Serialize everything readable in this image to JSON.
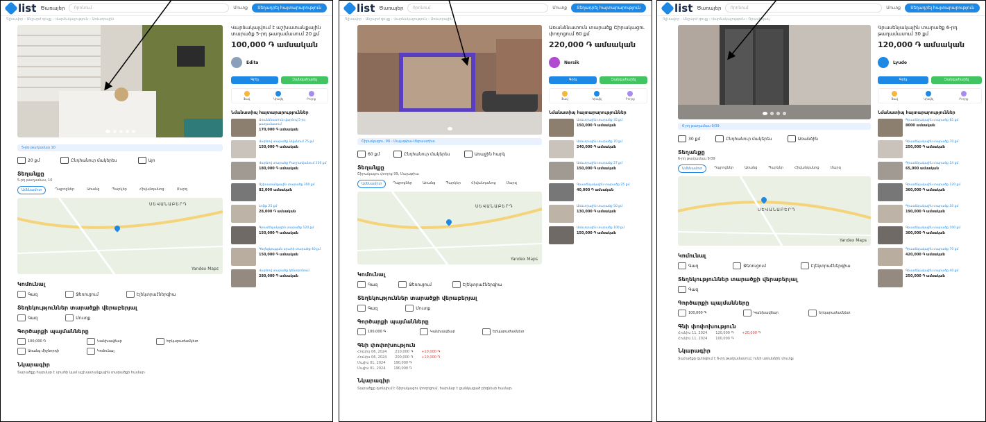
{
  "header": {
    "logo": "list",
    "category": "Ծառայեր",
    "search_placeholder": "Որոնում",
    "login": "Մուտք",
    "post_button": "Տեղադրել հայտարարություն"
  },
  "panels": [
    {
      "title": "Վարձակալվում է աշխատանքային տարածք 5-րդ թաղամասում 20 քմ",
      "price": "100,000 ֏ ամսական",
      "seller": "Edita",
      "strip": "5-րդ թաղամաս 10",
      "features": [
        "20 քմ",
        "Ընդհանուր մակերես",
        "Այո"
      ],
      "address": "5-րդ թաղամաս, 10",
      "similar": [
        {
          "t": "Առանձնատուն վարձով 5-րդ թաղամասում",
          "p": "170,000 ֏ ամսական"
        },
        {
          "t": "Վարձով տարածք Ավանում 75 քմ",
          "p": "150,000 ֏ ամսական"
        },
        {
          "t": "Վարձով տարածք Բաղրամյանում 130 քմ",
          "p": "180,000 ֏ ամսական"
        },
        {
          "t": "Աշխատանքային տարածք 300 քմ",
          "p": "82,000 ամսական"
        },
        {
          "t": "Լոֆթ 25 քմ",
          "p": "28,000 ֏ ամսական"
        },
        {
          "t": "Գրասենյակային տարածք 120 քմ",
          "p": "150,000 ֏ ամսական"
        },
        {
          "t": "Գեղեցկության սրահի տարածք 40 քմ",
          "p": "150,000 ֏ ամսական"
        },
        {
          "t": "Վարձով տարածք կենտրոնում",
          "p": "280,000 ֏ ամսական"
        }
      ],
      "price_history": [],
      "desc": "Տարածքը հարմար է սրահի կամ աշխատանքային տարածքի համար։"
    },
    {
      "title": "Առանձնատուն տարածք Շիրակացու փողոցում 60 քմ",
      "price": "220,000 ֏ ամսական",
      "seller": "Nersik",
      "strip": "Շիրակացու, 99 - Մալաթիա-Սեբաստիա",
      "features": [
        "60 քմ",
        "Ընդհանուր մակերես",
        "Առաջին հարկ"
      ],
      "address": "Շիրակացու փողոց 99, Մալաթիա",
      "similar": [
        {
          "t": "Առևտրային տարածք 35 քմ",
          "p": "150,000 ֏ ամսական"
        },
        {
          "t": "Առևտրային տարածք 70 քմ",
          "p": "240,000 ֏ ամսական"
        },
        {
          "t": "Առևտրային տարածք 27 քմ",
          "p": "150,000 ֏ ամսական"
        },
        {
          "t": "Գրասենյակային տարածք 25 քմ",
          "p": "40,000 ֏ ամսական"
        },
        {
          "t": "Առևտրային տարածք 50 քմ",
          "p": "130,000 ֏ ամսական"
        },
        {
          "t": "Առևտրային տարածք 100 քմ",
          "p": "150,000 ֏ ամսական"
        }
      ],
      "price_history": [
        {
          "d": "Հունիս 06, 2024",
          "v": "210,000 ֏",
          "c": "+10,000 ֏"
        },
        {
          "d": "Հունիս 06, 2024",
          "v": "200,000 ֏",
          "c": "+10,000 ֏"
        },
        {
          "d": "Մայիս 01, 2024",
          "v": "190,000 ֏",
          "c": ""
        },
        {
          "d": "Մայիս 01, 2024",
          "v": "190,000 ֏",
          "c": ""
        }
      ],
      "desc": "Տարածքը գտնվում է Շիրակացու փողոցում, հարմար է ցանկացած բիզնեսի համար։"
    },
    {
      "title": "Գրասենյակային տարածք 6-րդ թաղամասում 30 քմ",
      "price": "120,000 ֏ ամսական",
      "seller": "Lyudo",
      "strip": "6-րդ թաղամաս 9/39",
      "features": [
        "30 քմ",
        "Ընդհանուր մակերես",
        "Առանձին"
      ],
      "address": "6-րդ թաղամաս 9/39",
      "similar": [
        {
          "t": "Գրասենյակային տարածք 85 քմ",
          "p": "8000 ամսական"
        },
        {
          "t": "Գրասենյակային տարածք 70 քմ",
          "p": "250,000 ֏ ամսական"
        },
        {
          "t": "Գրասենյակային տարածք 24 քմ",
          "p": "65,000 ամսական"
        },
        {
          "t": "Գրասենյակային տարածք 120 քմ",
          "p": "360,000 ֏ ամսական"
        },
        {
          "t": "Գրասենյակային տարածք 50 քմ",
          "p": "190,000 ֏ ամսական"
        },
        {
          "t": "Գրասենյակային տարածք 100 քմ",
          "p": "300,000 ֏ ամսական"
        },
        {
          "t": "Գրասենյակային տարածք 70 քմ",
          "p": "420,000 ֏ ամսական"
        },
        {
          "t": "Գրասենյակային տարածք 40 քմ",
          "p": "250,000 ֏ ամսական"
        }
      ],
      "price_history": [
        {
          "d": "Հունիս 11, 2024",
          "v": "120,000 ֏",
          "c": "+20,000 ֏"
        },
        {
          "d": "Հունիս 11, 2024",
          "v": "100,000 ֏",
          "c": ""
        }
      ],
      "desc": "Տարածքը գտնվում է 6-րդ թաղամասում, ունի առանձին մուտք։"
    }
  ],
  "labels": {
    "write": "Գրել",
    "call": "Զանգահարել",
    "location": "Տեղանքը",
    "amenities": "Կոմունալ",
    "restrictions": "Տեղեկություններ տարածքի վերաբերյալ",
    "additional": "Գործարքի պայմանները",
    "price_history": "Գնի փոփոխություն",
    "description": "Նկարագիր",
    "similar": "Նմանատիպ հայտարարություններ",
    "map_city": "ՍԵՎԱՆԱԲԵՐԴ",
    "map_credit": "Yandex Maps",
    "tabs": [
      "Ամենամոտ",
      "Դպրոցներ",
      "Առանց",
      "Պարկեր",
      "Հիվանդանոց",
      "Մարզ"
    ],
    "amen": [
      "Գազ",
      "Ջեռուցում",
      "Էլեկտրաէներգիա"
    ],
    "r1": [
      "Գազ",
      "Մուտք"
    ],
    "cond": [
      "100,000 ֏",
      "Կանխավճար",
      "Երկարաժամկետ",
      "Առանց միջնորդի",
      "Կոմունալ"
    ]
  },
  "colors": {
    "accent": "#1e88e5",
    "green": "#43c463"
  }
}
